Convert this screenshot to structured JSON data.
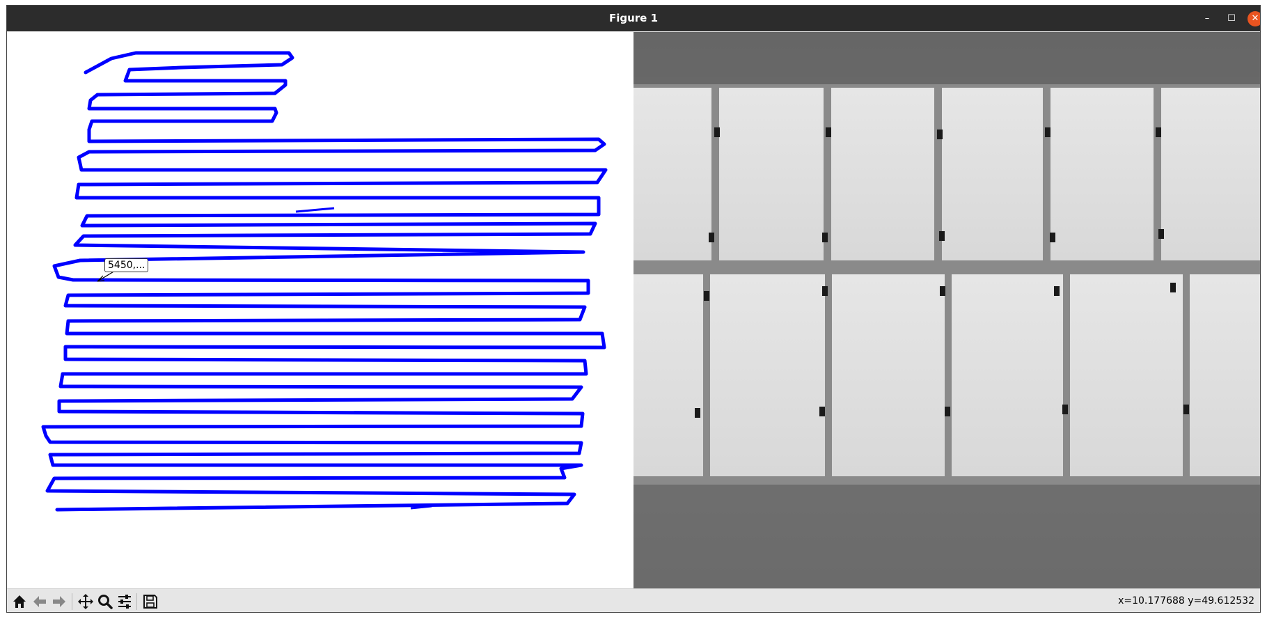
{
  "window": {
    "title": "Figure 1",
    "buttons": {
      "minimize": "–",
      "maximize": "☐",
      "close": "✕"
    }
  },
  "plot": {
    "path_color": "#0000ff",
    "annotation": "5450,..."
  },
  "image": {
    "description_hidden": "",
    "panels": {
      "cols": 6,
      "rows": 2
    }
  },
  "toolbar": {
    "icons": [
      "home-icon",
      "back-icon",
      "forward-icon",
      "pan-icon",
      "zoom-icon",
      "configure-subplots-icon",
      "save-icon"
    ]
  },
  "status": {
    "coords": "x=10.177688 y=49.612532"
  }
}
